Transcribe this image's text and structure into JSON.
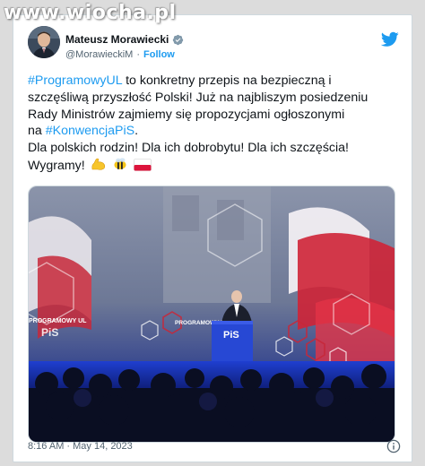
{
  "watermark": "www.wiocha.pl",
  "author": {
    "name": "Mateusz Morawiecki",
    "handle": "@MorawieckiM",
    "follow_label": "Follow"
  },
  "tweet": {
    "line1_tag": "#ProgramowyUL",
    "line1_rest": " to konkretny przepis na bezpieczną i",
    "line2": "szczęśliwą przyszłość Polski! Już na najbliszym posiedzeniu",
    "line3": "Rady Ministrów zajmiemy się propozycjami ogłoszonymi",
    "line4_prefix": "na ",
    "line4_tag": "#KonwencjaPiS",
    "line4_suffix": ".",
    "line5": "Dla polskich rodzin! Dla ich dobrobytu! Dla ich szczęścia!",
    "line6": "Wygramy!"
  },
  "media": {
    "podium_text": "PiS",
    "screen_text_left": "PROGRAMOWY UL",
    "screen_text_right": "PROGRAMOWY UL",
    "logo_text": "PiS"
  },
  "timestamp": "8:16 AM · May 14, 2023",
  "colors": {
    "link": "#1d9bf0",
    "text": "#0f1419",
    "secondary": "#536471",
    "stage_blue": "#1f3fd0"
  },
  "icons": {
    "verified": "verified-badge-icon",
    "twitter": "twitter-bird-icon",
    "info": "info-icon"
  }
}
